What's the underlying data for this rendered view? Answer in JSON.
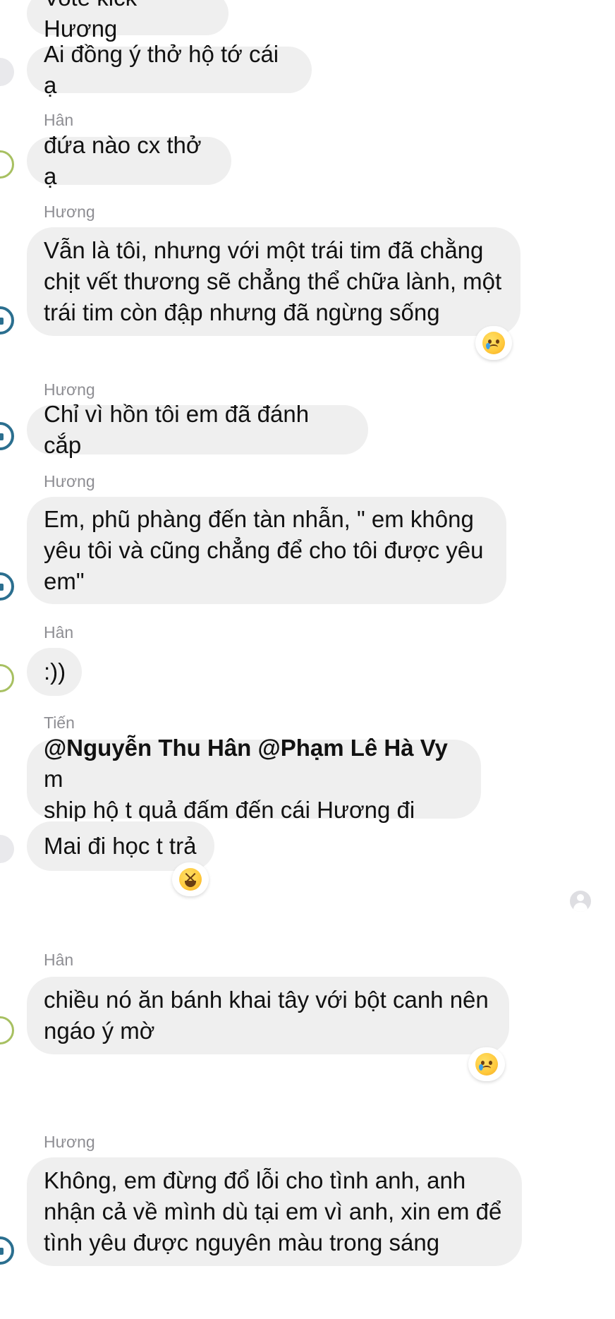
{
  "messages": [
    {
      "sender": "",
      "text": "Vote kick Hương"
    },
    {
      "sender": "",
      "text": "Ai đồng ý thở hộ tớ cái ạ"
    },
    {
      "sender": "Hân",
      "text": "đứa nào cx thở ạ"
    },
    {
      "sender": "Hương",
      "text": "Vẫn là tôi, nhưng với một trái tim đã chằng\nchịt vết thương sẽ chẳng thể chữa lành, một\ntrái tim còn đập nhưng đã ngừng sống",
      "reaction": "crying-face"
    },
    {
      "sender": "Hương",
      "text": "Chỉ vì hồn tôi em đã đánh cắp"
    },
    {
      "sender": "Hương",
      "text": "Em, phũ phàng đến tàn nhẫn, \" em không\nyêu tôi và cũng chẳng để cho tôi được yêu\nem\""
    },
    {
      "sender": "Hân",
      "text": ":))"
    },
    {
      "sender": "Tiến",
      "mentions": [
        "@Nguyễn Thu Hân",
        "@Phạm Lê Hà Vy"
      ],
      "text": " m\nship hộ t quả đấm đến cái Hương đi"
    },
    {
      "sender": "",
      "text": "Mai đi học t trả",
      "reaction": "grinning-squinting-face"
    },
    {
      "sender": "Hân",
      "text": "chiều nó ăn bánh khai tây với bột canh nên\nngáo ý mờ",
      "reaction": "crying-face"
    },
    {
      "sender": "Hương",
      "text": "Không, em đừng đổ lỗi cho tình anh, anh\nnhận cả về mình dù tại em vì anh, xin em để\ntình yêu được nguyên màu trong sáng"
    }
  ],
  "colors": {
    "bubble": "#efefef",
    "sender_name": "#8e8e93",
    "avatar_green_ring": "#a7c061",
    "avatar_blue_ring": "#2b6f8f"
  }
}
